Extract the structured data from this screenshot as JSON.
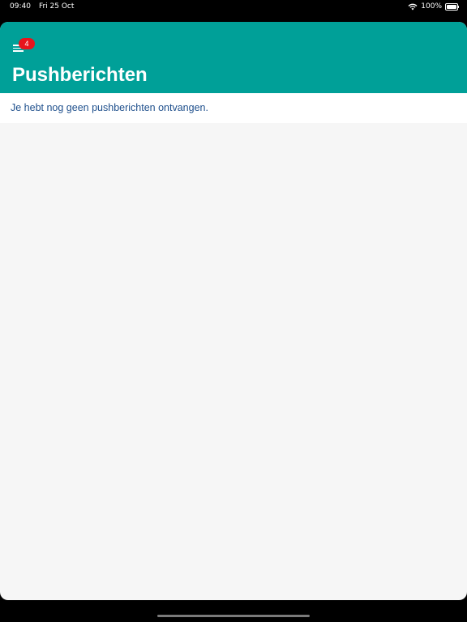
{
  "status_bar": {
    "time": "09:40",
    "date": "Fri 25 Oct",
    "battery": "100%",
    "icons": [
      "wifi-icon",
      "battery-icon"
    ]
  },
  "header": {
    "title": "Pushberichten",
    "menu_icon": "menu-icon",
    "badge_count": "4",
    "background_color": "#00a098"
  },
  "content": {
    "empty_message": "Je hebt nog geen pushberichten ontvangen."
  },
  "colors": {
    "header": "#00a098",
    "badge": "#e8141c",
    "message_text": "#1e4f8c",
    "background": "#f6f6f6"
  }
}
